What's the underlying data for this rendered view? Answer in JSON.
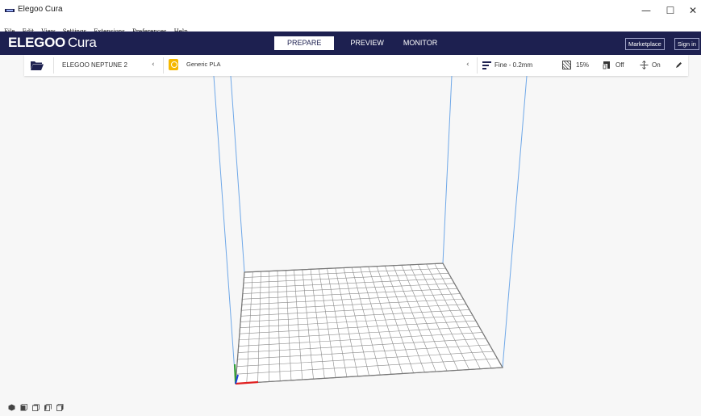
{
  "window": {
    "title": "Elegoo Cura",
    "controls": {
      "minimize": "—",
      "maximize": "☐",
      "close": "✕"
    }
  },
  "menu": {
    "items": [
      "File",
      "Edit",
      "View",
      "Settings",
      "Extensions",
      "Preferences",
      "Help"
    ]
  },
  "app": {
    "logo_brand": "ELEGOO",
    "logo_product": "Cura",
    "stages": [
      {
        "label": "PREPARE",
        "active": true
      },
      {
        "label": "PREVIEW",
        "active": false
      },
      {
        "label": "MONITOR",
        "active": false
      }
    ],
    "marketplace_label": "Marketplace",
    "signin_label": "Sign in",
    "colors": {
      "header": "#1d2050",
      "accent": "#f5b800",
      "build_plate_grid": "#8a8a8a",
      "volume_edge": "#6fa8e8"
    }
  },
  "toolbar": {
    "open_icon": "folder-open-icon",
    "machine_name": "ELEGOO NEPTUNE 2",
    "material_name": "Generic PLA",
    "profile": "Fine - 0.2mm",
    "infill": "15%",
    "support": "Off",
    "adhesion": "On"
  },
  "camera": {
    "icons": [
      "3d-view-icon",
      "front-view-icon",
      "top-view-icon",
      "left-view-icon",
      "right-view-icon"
    ]
  }
}
